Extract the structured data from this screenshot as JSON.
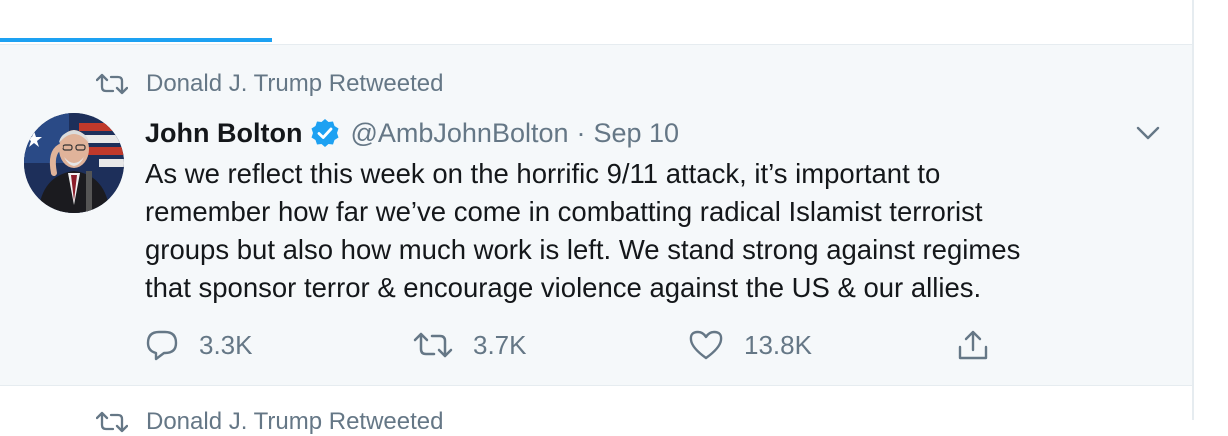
{
  "colors": {
    "accent": "#1da1f2",
    "secondary_text": "#657786",
    "primary_text": "#14171a",
    "tweet_bg": "#f5f8fa",
    "divider": "#e6ecf0"
  },
  "tweet": {
    "retweet_context": "Donald J. Trump Retweeted",
    "author": {
      "name": "John Bolton",
      "verified": true,
      "handle": "@AmbJohnBolton",
      "separator": "·",
      "time": "Sep 10"
    },
    "text_lines": [
      "As we reflect this week on the horrific 9/11 attack, it’s important to",
      "remember how far we’ve come in combatting radical Islamist terrorist",
      "groups but also how much work is left. We stand strong against regimes",
      "that sponsor terror & encourage violence against the US & our allies."
    ],
    "actions": {
      "replies": "3.3K",
      "retweets": "3.7K",
      "likes": "13.8K"
    }
  },
  "next_tweet": {
    "retweet_context": "Donald J. Trump Retweeted"
  },
  "icons": [
    "retweet-icon",
    "verified-badge-icon",
    "chevron-down-icon",
    "reply-icon",
    "like-icon",
    "share-icon"
  ]
}
